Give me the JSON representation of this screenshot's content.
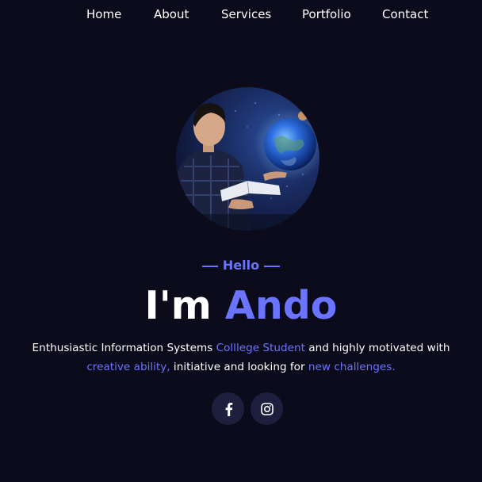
{
  "nav": {
    "items": [
      {
        "label": "Home"
      },
      {
        "label": "About"
      },
      {
        "label": "Services"
      },
      {
        "label": "Portfolio"
      },
      {
        "label": "Contact"
      }
    ]
  },
  "hero": {
    "greeting": "Hello",
    "headline_prefix": "I'm",
    "headline_name": "Ando",
    "description": {
      "part1": "Enthusiastic Information Systems ",
      "highlight1": "Colllege Student",
      "part2": " and highly motivated with",
      "highlight2": "creative ability,",
      "part3": " initiative and looking for ",
      "highlight3": "new challenges."
    }
  },
  "social": [
    {
      "icon": "facebook-icon"
    },
    {
      "icon": "instagram-icon"
    }
  ],
  "colors": {
    "background": "#0b0b1c",
    "accent": "#6b74ff",
    "text": "#ffffff",
    "social_bg": "#1d1f3d"
  }
}
